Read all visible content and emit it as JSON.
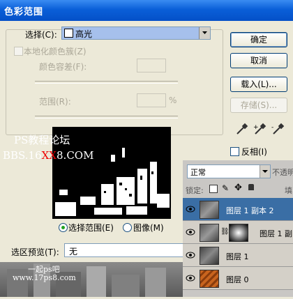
{
  "window": {
    "title": "色彩范围"
  },
  "select": {
    "label": "选择(C):",
    "value": "高光"
  },
  "localized": {
    "label": "本地化颜色簇(Z)"
  },
  "fuzziness": {
    "label": "颜色容差(F):"
  },
  "range": {
    "label": "范围(R):",
    "unit": "%"
  },
  "buttons": {
    "ok": "确定",
    "cancel": "取消",
    "load": "载入(L)...",
    "save": "存储(S)..."
  },
  "invert": {
    "label": "反相(I)"
  },
  "view": {
    "selection": "选择范围(E)",
    "image": "图像(M)"
  },
  "preview": {
    "label": "选区预览(T):",
    "value": "无"
  },
  "watermark": {
    "line1": "PS教程论坛",
    "line2a": "BBS.16",
    "line2b": "XX",
    "line2c": "8.COM",
    "bottom": "一起ps吧",
    "url": "www.17ps8.com"
  },
  "layers_panel": {
    "blend_mode": "正常",
    "opacity_label": "不透明",
    "lock_label": "锁定:",
    "fill_label": "填",
    "layers": [
      {
        "name": "图层 1 副本 2",
        "selected": true
      },
      {
        "name": "图层 1 副",
        "selected": false
      },
      {
        "name": "图层 1",
        "selected": false
      },
      {
        "name": "图层 0",
        "selected": false
      }
    ]
  }
}
